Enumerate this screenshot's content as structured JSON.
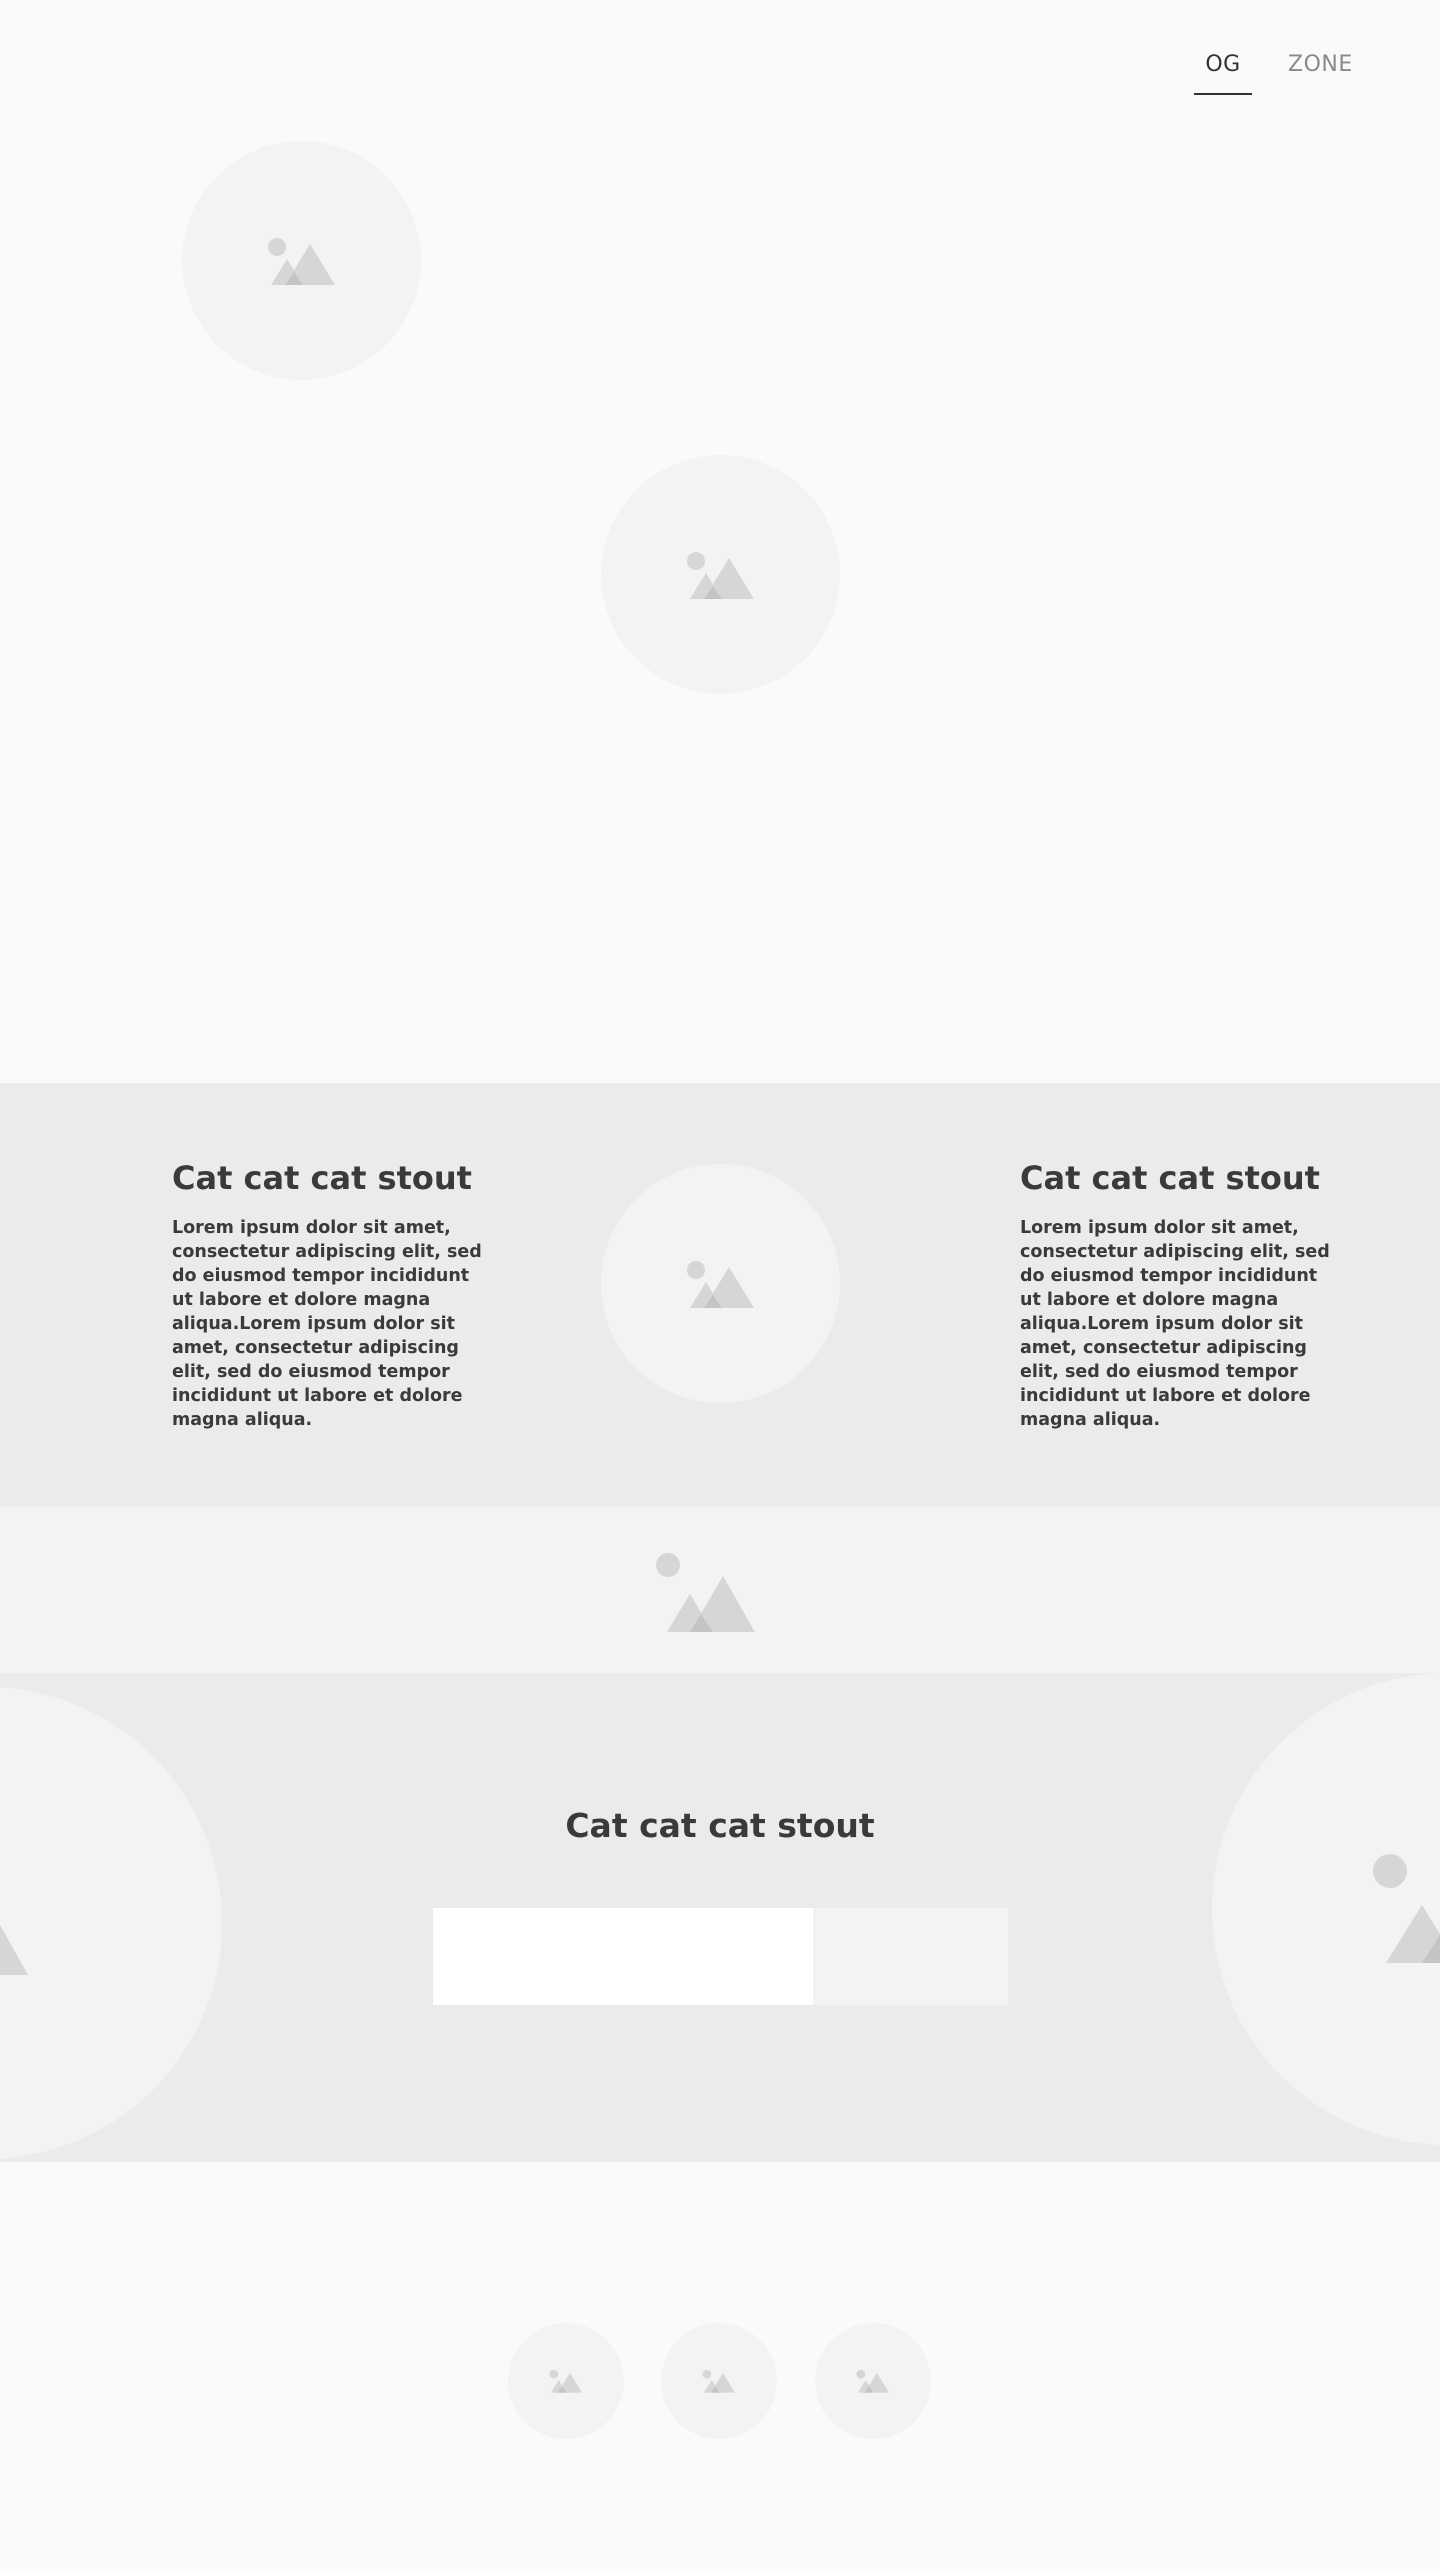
{
  "nav": {
    "items": [
      {
        "label": "OG",
        "active": true
      },
      {
        "label": "ZONE",
        "active": false
      }
    ]
  },
  "features": [
    {
      "title": "Cat cat cat stout",
      "body": "Lorem ipsum dolor sit amet, consectetur adipiscing elit, sed do eiusmod tempor incididunt ut labore et dolore magna aliqua.Lorem ipsum dolor sit amet, consectetur adipiscing elit, sed do eiusmod tempor incididunt ut labore et dolore magna aliqua."
    },
    {
      "title": "Cat cat cat stout",
      "body": "Lorem ipsum dolor sit amet, consectetur adipiscing elit, sed do eiusmod tempor incididunt ut labore et dolore magna aliqua.Lorem ipsum dolor sit amet, consectetur adipiscing elit, sed do eiusmod tempor incididunt ut labore et dolore magna aliqua."
    }
  ],
  "cta": {
    "title": "Cat cat cat stout",
    "input_value": "",
    "button_label": ""
  },
  "colors": {
    "page_bg": "#fafafa",
    "band_dark": "#ebebeb",
    "band_light": "#f3f3f3",
    "placeholder_circle": "#f3f3f3",
    "placeholder_icon": "#d6d6d6",
    "text": "#3a3a3a",
    "nav_inactive": "#8a8a8a"
  },
  "icons": {
    "image_placeholder": "image-placeholder-icon"
  }
}
